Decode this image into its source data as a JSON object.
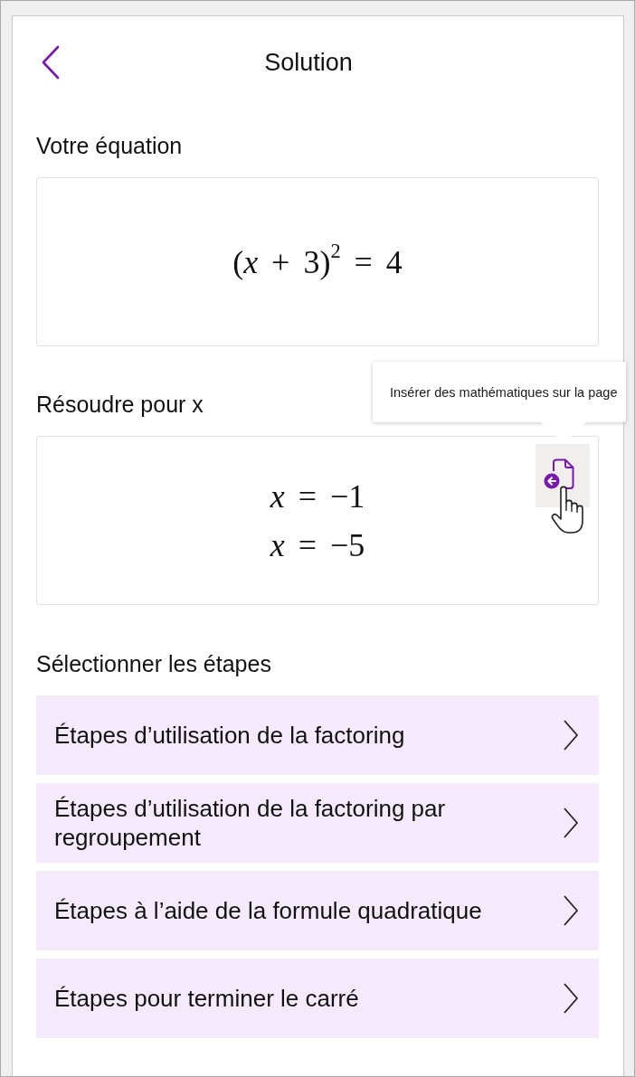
{
  "header": {
    "title": "Solution"
  },
  "equation_section": {
    "label": "Votre équation",
    "equation": "(*x* + 3)$^{2}$ = 4"
  },
  "solve_section": {
    "label": "Résoudre pour x",
    "solutions": [
      "*x* = −1",
      "*x* = −5"
    ],
    "insert_button": {
      "hovered": true,
      "tooltip": "Insérer des mathématiques sur la page"
    }
  },
  "steps_section": {
    "label": "Sélectionner les étapes",
    "options": [
      "Étapes d’utilisation de la factoring",
      "Étapes d’utilisation de la factoring par regroupement",
      "Étapes à l’aide de la formule quadratique",
      "Étapes pour terminer le carré"
    ]
  }
}
